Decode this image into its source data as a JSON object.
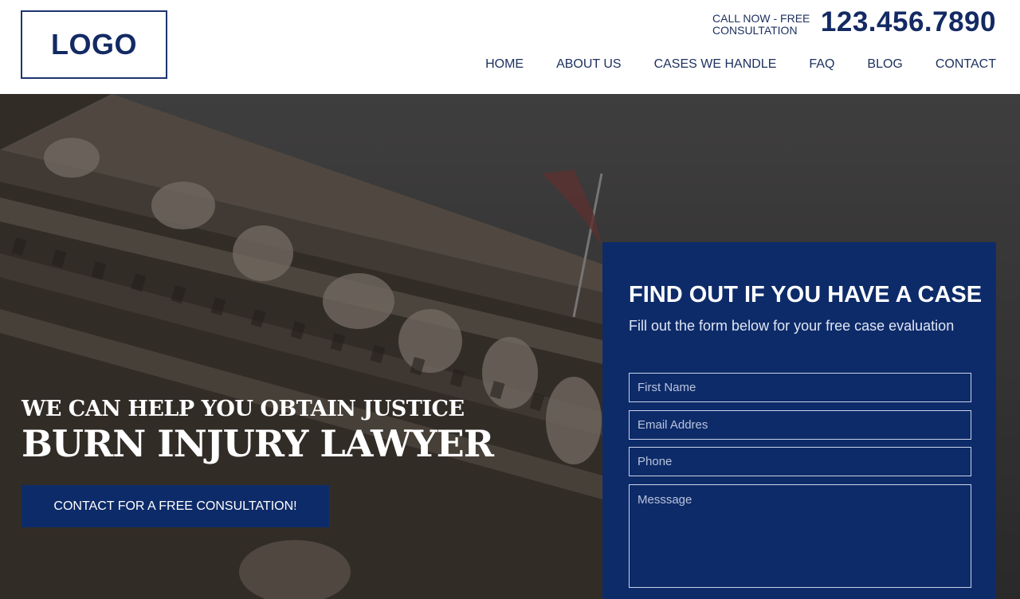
{
  "header": {
    "logo": "LOGO",
    "call_label": "CALL NOW - FREE CONSULTATION",
    "phone": "123.456.7890",
    "nav": [
      "HOME",
      "ABOUT US",
      "CASES WE HANDLE",
      "FAQ",
      "BLOG",
      "CONTACT"
    ]
  },
  "hero": {
    "tagline": "WE CAN HELP YOU OBTAIN JUSTICE",
    "headline": "BURN INJURY LAWYER",
    "cta": "CONTACT FOR A FREE CONSULTATION!"
  },
  "form": {
    "title": "FIND OUT IF YOU HAVE A CASE",
    "subtitle": "Fill out the form below for your free case evaluation",
    "first_name_placeholder": "First Name",
    "email_placeholder": "Email Addres",
    "phone_placeholder": "Phone",
    "message_placeholder": "Messsage"
  },
  "colors": {
    "brand_navy": "#0e2b69",
    "text_navy": "#1c2f5e",
    "header_bg": "#ffffff"
  }
}
